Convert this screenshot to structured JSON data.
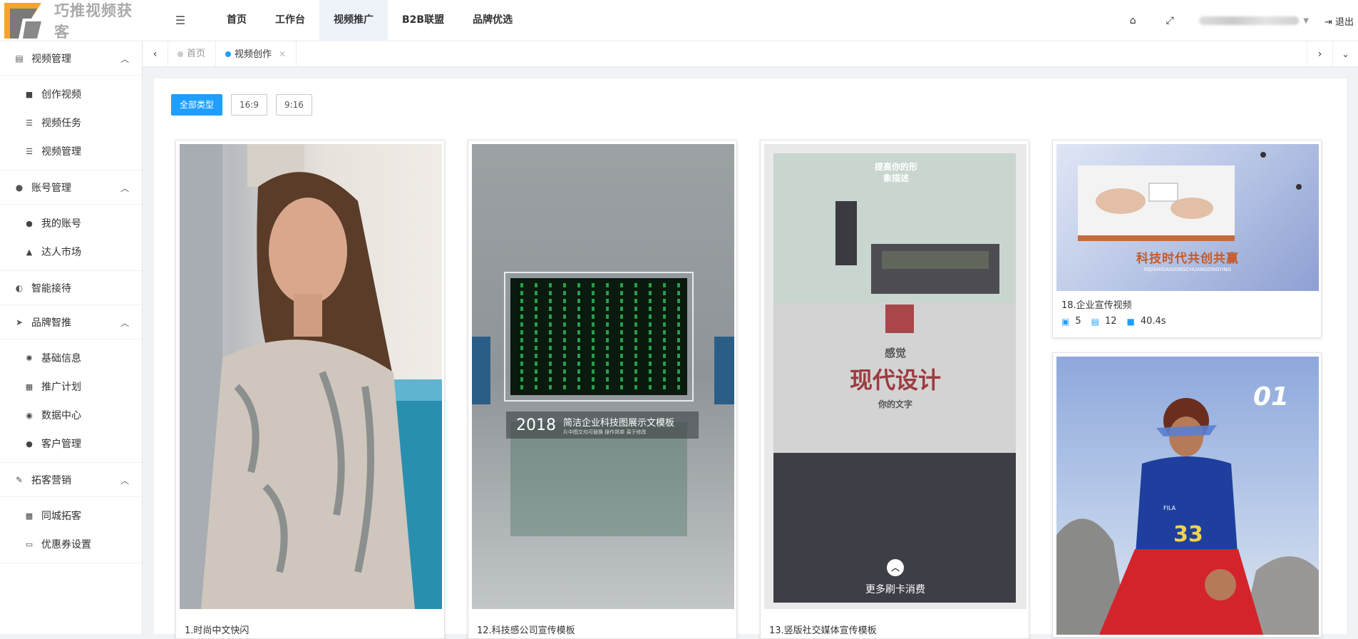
{
  "app": {
    "logo_text": "巧推视频获客"
  },
  "nav": {
    "items": [
      "首页",
      "工作台",
      "视频推广",
      "B2B联盟",
      "品牌优选"
    ],
    "active": 2
  },
  "topright": {
    "home_icon": "home-icon",
    "fullscreen_icon": "fullscreen-icon",
    "logout": "退出"
  },
  "sidebar": {
    "groups": [
      {
        "label": "视频管理",
        "icon": "video-doc-icon",
        "expanded": true,
        "items": [
          {
            "label": "创作视频",
            "icon": "camera-icon"
          },
          {
            "label": "视频任务",
            "icon": "task-list-icon"
          },
          {
            "label": "视频管理",
            "icon": "list-icon"
          }
        ]
      },
      {
        "label": "账号管理",
        "icon": "users-icon",
        "expanded": true,
        "items": [
          {
            "label": "我的账号",
            "icon": "user-icon"
          },
          {
            "label": "达人市场",
            "icon": "lock-icon"
          }
        ]
      },
      {
        "label": "智能接待",
        "icon": "handshake-icon",
        "expanded": false,
        "items": []
      },
      {
        "label": "品牌智推",
        "icon": "rocket-icon",
        "expanded": true,
        "items": [
          {
            "label": "基础信息",
            "icon": "gear-icon"
          },
          {
            "label": "推广计划",
            "icon": "calculator-icon"
          },
          {
            "label": "数据中心",
            "icon": "dashboard-icon"
          },
          {
            "label": "客户管理",
            "icon": "users-icon"
          }
        ]
      },
      {
        "label": "拓客营销",
        "icon": "pen-icon",
        "expanded": true,
        "items": [
          {
            "label": "同城拓客",
            "icon": "qrcode-icon"
          },
          {
            "label": "优惠券设置",
            "icon": "card-icon"
          }
        ]
      }
    ]
  },
  "tabs": [
    {
      "label": "首页",
      "active": false,
      "closable": false
    },
    {
      "label": "视频创作",
      "active": true,
      "closable": true
    }
  ],
  "filters": [
    {
      "label": "全部类型",
      "active": true
    },
    {
      "label": "16:9",
      "active": false
    },
    {
      "label": "9:16",
      "active": false
    }
  ],
  "templates": [
    {
      "title": "1.时尚中文快闪"
    },
    {
      "title": "12.科技感公司宣传模板",
      "overlay": {
        "year": "2018",
        "headline": "简洁企业科技图展示文模板",
        "subline": "片中图文均可替换 操作简单 易于修改"
      }
    },
    {
      "title": "13.竖版社交媒体宣传模板",
      "overlay": {
        "top": "提高你的形象描述",
        "mid1": "感觉",
        "mid2": "现代设计",
        "mid3": "你的文字",
        "bottom": "更多刷卡消费"
      }
    },
    {
      "title": "18.企业宣传视频",
      "stats": {
        "images": "5",
        "texts": "12",
        "duration": "40.4s"
      },
      "overlay": {
        "title": "科技时代共创共赢",
        "subtitle": "KEJISHIDAIGONGCHUANGONGYING"
      }
    },
    {
      "title": "",
      "overlay": {
        "number": "01",
        "jersey": "33",
        "brand": "FILA"
      }
    }
  ],
  "colors": {
    "accent": "#1e9fff",
    "logo_orange": "#f5a623",
    "logo_gray": "#7a7a7a"
  }
}
